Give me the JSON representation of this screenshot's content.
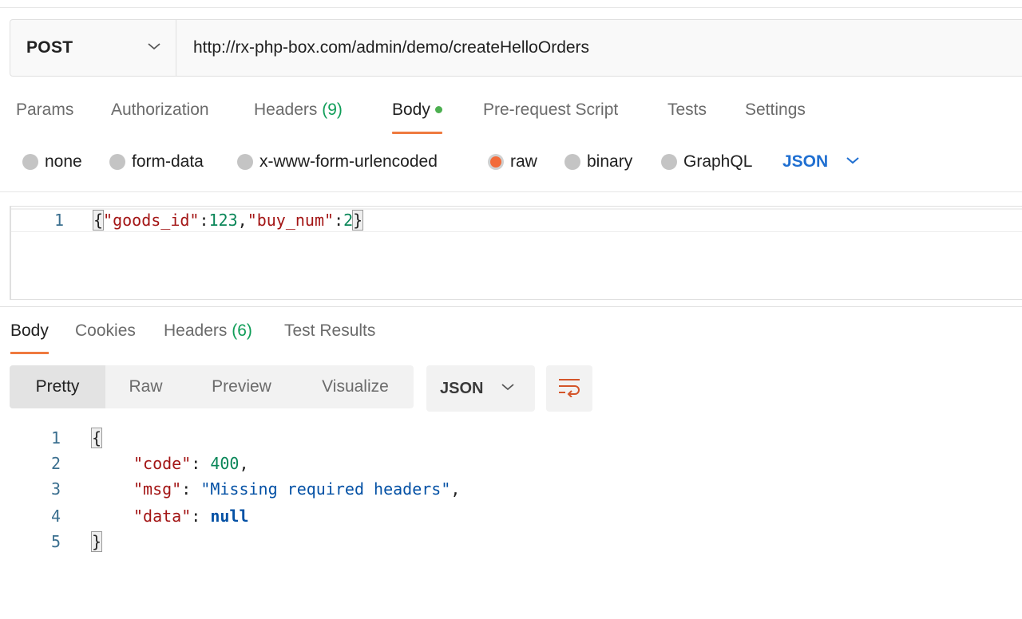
{
  "request": {
    "method": "POST",
    "url": "http://rx-php-box.com/admin/demo/createHelloOrders"
  },
  "request_tabs": [
    {
      "label": "Params"
    },
    {
      "label": "Authorization"
    },
    {
      "label": "Headers",
      "count": "(9)"
    },
    {
      "label": "Body"
    },
    {
      "label": "Pre-request Script"
    },
    {
      "label": "Tests"
    },
    {
      "label": "Settings"
    }
  ],
  "body_types": [
    "none",
    "form-data",
    "x-www-form-urlencoded",
    "raw",
    "binary",
    "GraphQL"
  ],
  "body_language": "JSON",
  "request_editor": {
    "line_number": "1",
    "open": "{",
    "key1": "\"goods_id\"",
    "colon1": ":",
    "val1": "123",
    "comma": ",",
    "key2": "\"buy_num\"",
    "colon2": ":",
    "val2": "2",
    "close": "}"
  },
  "response_tabs": [
    {
      "label": "Body"
    },
    {
      "label": "Cookies"
    },
    {
      "label": "Headers",
      "count": "(6)"
    },
    {
      "label": "Test Results"
    }
  ],
  "response_views": [
    "Pretty",
    "Raw",
    "Preview",
    "Visualize"
  ],
  "response_format": "JSON",
  "response_body": {
    "line_numbers": [
      "1",
      "2",
      "3",
      "4",
      "5"
    ],
    "open": "{",
    "code_key": "\"code\"",
    "code_val": "400",
    "msg_key": "\"msg\"",
    "msg_val": "\"Missing required headers\"",
    "data_key": "\"data\"",
    "data_val": "null",
    "close": "}",
    "sep": ": ",
    "comma": ","
  },
  "colors": {
    "accent": "#ef7a3f",
    "link_blue": "#1f6fd1",
    "count_green": "#0f9d58",
    "dot_green": "#4caf50"
  },
  "icons": {
    "method_dropdown": "chevron-down-icon",
    "language_dropdown": "chevron-down-icon",
    "format_dropdown": "chevron-down-icon",
    "wrap": "wrap-lines-icon"
  }
}
